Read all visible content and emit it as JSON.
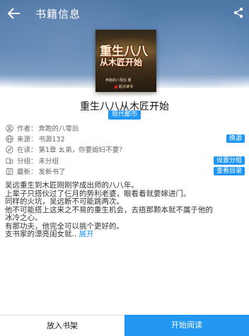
{
  "toolbar": {
    "title": "书籍信息",
    "back_icon": "arrow-left-icon",
    "share_icon": "share-icon"
  },
  "cover": {
    "title_line1": "重生八八",
    "title_line2": "从木匠开始",
    "author_text": "奔跑的八零后 著",
    "publisher": "起点读书"
  },
  "book": {
    "title": "重生八八从木匠开始",
    "category": "现代都市"
  },
  "info": {
    "author_label": "作者：",
    "author": "奔跑的八零后",
    "source_label": "来源：",
    "source": "书源132",
    "source_button": "换源",
    "reading_label": "在读：",
    "reading": "第1章 幺弟，你要媳妇不要？",
    "group_label": "分组：",
    "group": "未分组",
    "group_button": "设置分组",
    "latest_label": "最新：",
    "latest": "发新书了",
    "catalog_button": "查看目录"
  },
  "description": {
    "line1": "吴远重生到木匠刚刚学成出师的八八年。",
    "line2": "上辈子只搭伙过了仨月的势利老婆，眼看着就要嫁进门。",
    "line3": "同样的火坑，吴远断不可能跳两次。",
    "line4": "他不可能搭上这来之不易的重生机会，去捂那颗本就不属于他的",
    "line5": "冰冷之心。",
    "line6": "有那功夫，他完全可以挑个更好的。",
    "line7": "支书家的漂亮闺女就..",
    "expand": "展开"
  },
  "bottom": {
    "add_shelf": "放入书架",
    "start_reading": "开始阅读"
  },
  "colors": {
    "accent": "#2196f3",
    "header": "#5e87b6"
  }
}
